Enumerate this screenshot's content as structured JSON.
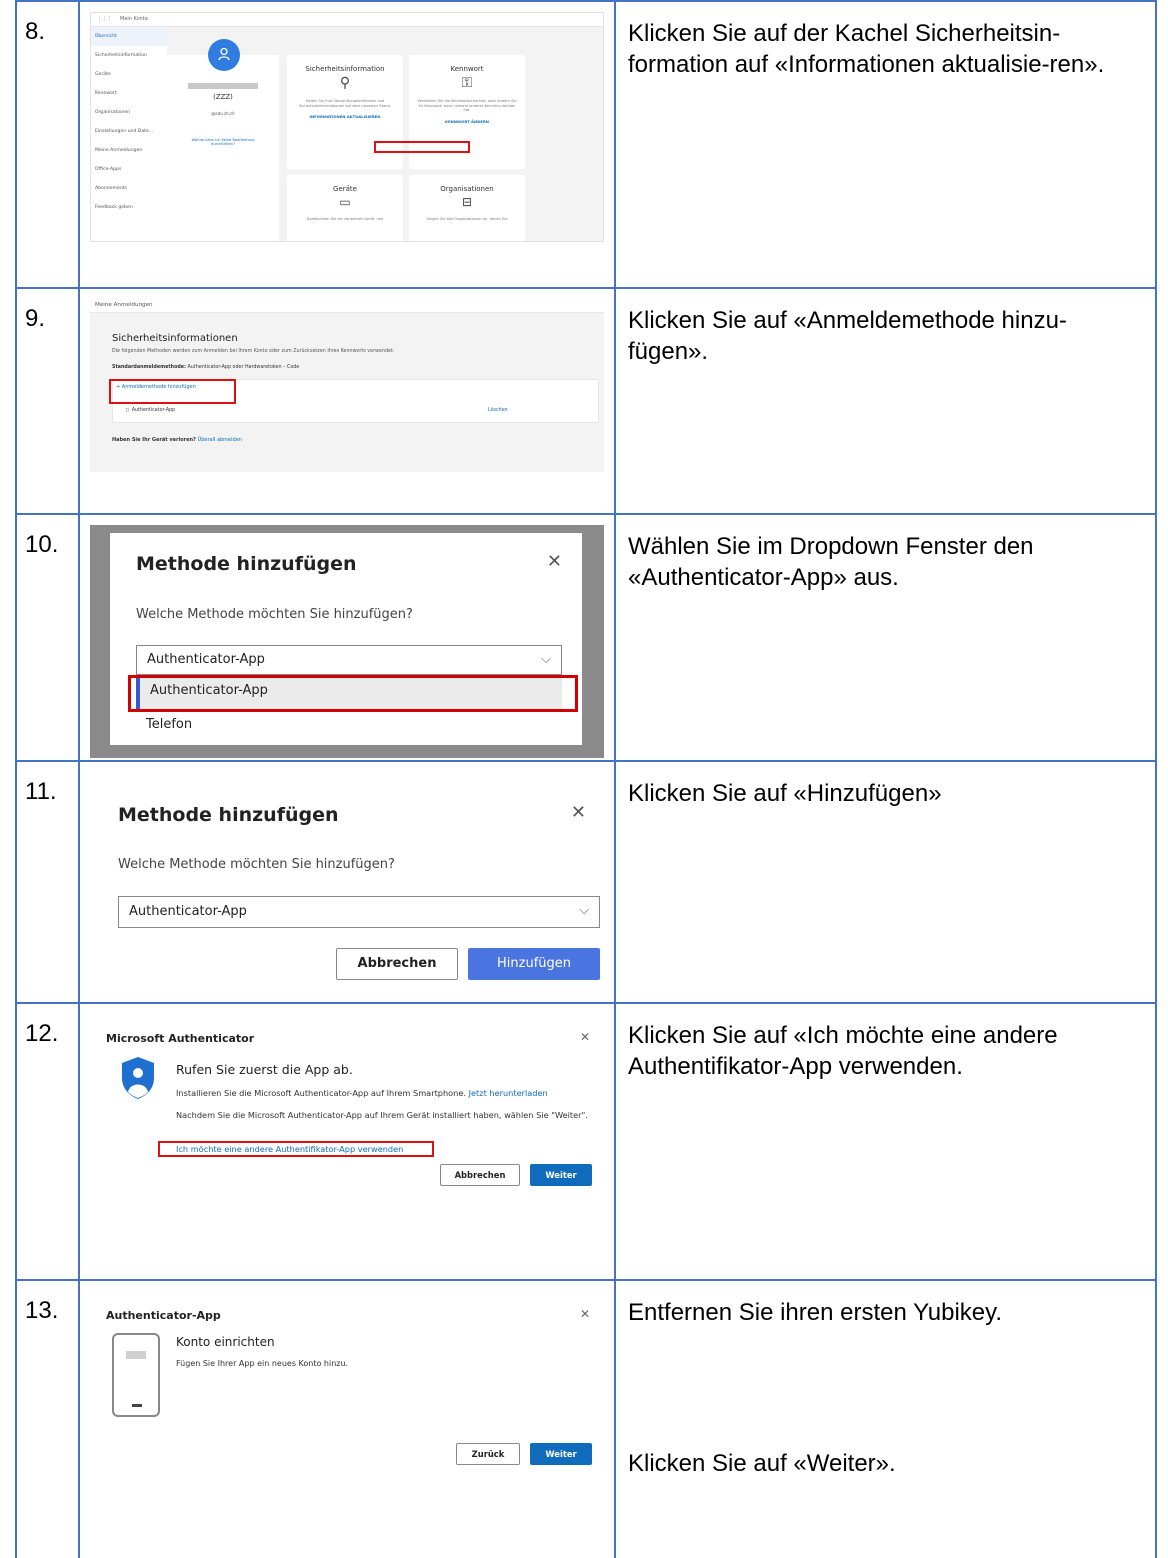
{
  "steps": [
    {
      "num": "8.",
      "text": "Klicken Sie auf der Kachel Sicherheitsin-formation auf «Informationen aktualisie-ren».",
      "screenshot": {
        "app_label": "Mein Konto",
        "nav": [
          "Übersicht",
          "Sicherheitsinformation",
          "Geräte",
          "Kennwort",
          "Organisationen",
          "Einstellungen und Date...",
          "Meine Anmeldungen",
          "Office-Apps",
          "Abonnements",
          "Feedback geben"
        ],
        "profile_name": "(ZZZ)",
        "profile_email": "@edu.zh.ch",
        "profile_link": "Warum kann ich keine Bearbeitung durchführen?",
        "tiles": [
          {
            "title": "Sicherheitsinformation",
            "text": "Halten Sie Ihre Überprüfungsmethoden und Sicherheitsinformationen auf dem neuesten Stand.",
            "link": "INFORMATIONEN AKTUALISIEREN"
          },
          {
            "title": "Kennwort",
            "text": "Verstärken Sie die Kennwortsicherheit, oder ändern Sie Ihr Kennwort, wenn jemand anderes Kenntnis darüber hat.",
            "link": "KENNWORT ÄNDERN"
          },
          {
            "title": "Geräte",
            "text": "Deaktivieren Sie ein verlorenes Gerät, und"
          },
          {
            "title": "Organisationen",
            "text": "Zeigen Sie alle Organisationen an, denen Sie"
          }
        ]
      }
    },
    {
      "num": "9.",
      "text": "Klicken Sie auf «Anmeldemethode hinzu-fügen».",
      "screenshot": {
        "top_label": "Meine Anmeldungen",
        "heading": "Sicherheitsinformationen",
        "subtitle": "Die folgenden Methoden werden zum Anmelden bei Ihrem Konto oder zum Zurücksetzen Ihres Kennworts verwendet.",
        "default_label": "Standardanmeldemethode:",
        "default_value": "Authenticator-App oder Hardwaretoken – Code",
        "add_link": "Anmeldemethode hinzufügen",
        "method": "Authenticator-App",
        "delete": "Löschen",
        "lost_text": "Haben Sie Ihr Gerät verloren?",
        "lost_link": "Überall abmelden"
      }
    },
    {
      "num": "10.",
      "text": "Wählen Sie im Dropdown Fenster den «Authenticator-App» aus.",
      "screenshot": {
        "title": "Methode hinzufügen",
        "question": "Welche Methode möchten Sie hinzufügen?",
        "selected": "Authenticator-App",
        "options": [
          "Authenticator-App",
          "Telefon"
        ]
      }
    },
    {
      "num": "11.",
      "text": "Klicken Sie auf «Hinzufügen»",
      "screenshot": {
        "title": "Methode hinzufügen",
        "question": "Welche Methode möchten Sie hinzufügen?",
        "selected": "Authenticator-App",
        "cancel": "Abbrechen",
        "add": "Hinzufügen"
      }
    },
    {
      "num": "12.",
      "text": "Klicken Sie auf «Ich möchte eine andere Authentifikator-App verwenden.",
      "screenshot": {
        "title": "Microsoft Authenticator",
        "heading": "Rufen Sie zuerst die App ab.",
        "p1": "Installieren Sie die Microsoft Authenticator-App auf Ihrem Smartphone.",
        "p1_link": "Jetzt herunterladen",
        "p2": "Nachdem Sie die Microsoft Authenticator-App auf Ihrem Gerät installiert haben, wählen Sie \"Weiter\".",
        "other_link": "Ich möchte eine andere Authentifikator-App verwenden",
        "cancel": "Abbrechen",
        "next": "Weiter"
      }
    },
    {
      "num": "13.",
      "text_1": "Entfernen Sie ihren ersten Yubikey.",
      "text_2": "Klicken Sie auf «Weiter».",
      "screenshot": {
        "title": "Authenticator-App",
        "heading": "Konto einrichten",
        "text": "Fügen Sie Ihrer App ein neues Konto hinzu.",
        "back": "Zurück",
        "next": "Weiter"
      }
    }
  ]
}
